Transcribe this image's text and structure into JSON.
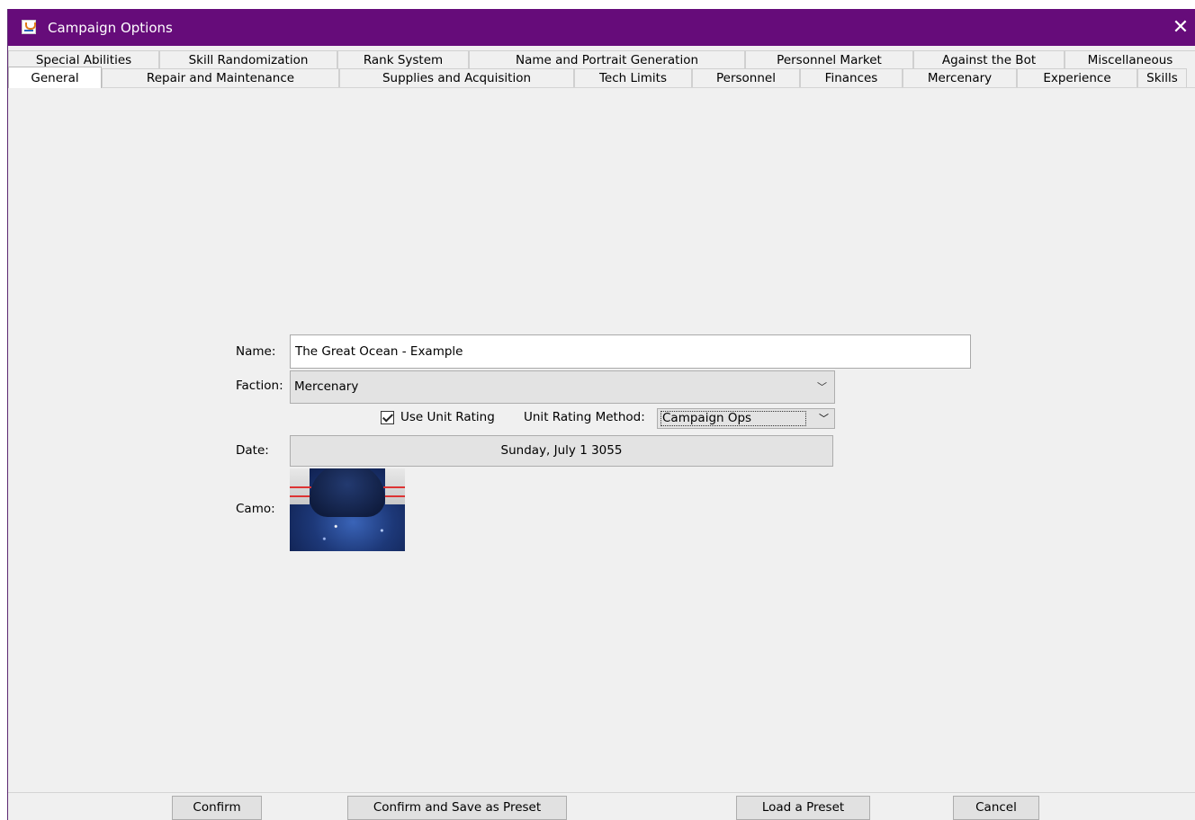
{
  "window": {
    "title": "Campaign Options",
    "app_icon": "java-cup-icon",
    "close_icon": "close-x-icon",
    "close_glyph": "✕"
  },
  "tabs": {
    "row1": [
      "Special Abilities",
      "Skill Randomization",
      "Rank System",
      "Name and Portrait Generation",
      "Personnel Market",
      "Against the Bot",
      "Miscellaneous"
    ],
    "row2": [
      "General",
      "Repair and Maintenance",
      "Supplies and Acquisition",
      "Tech Limits",
      "Personnel",
      "Finances",
      "Mercenary",
      "Experience",
      "Skills"
    ],
    "selected": "General"
  },
  "general": {
    "name_label": "Name:",
    "name_value": "The Great Ocean - Example",
    "faction_label": "Faction:",
    "faction_value": "Mercenary",
    "use_unit_rating_label": "Use Unit Rating",
    "use_unit_rating_checked": true,
    "unit_rating_method_label": "Unit Rating Method:",
    "unit_rating_method_value": "Campaign Ops",
    "date_label": "Date:",
    "date_value": "Sunday, July 1 3055",
    "camo_label": "Camo:"
  },
  "buttons": {
    "confirm": "Confirm",
    "confirm_save_preset": "Confirm and Save as Preset",
    "load_preset": "Load a Preset",
    "cancel": "Cancel"
  },
  "icons": {
    "dropdown": "chevron-down-icon",
    "dropdown_glyph": "﹀",
    "checkbox": "checkmark-icon"
  }
}
